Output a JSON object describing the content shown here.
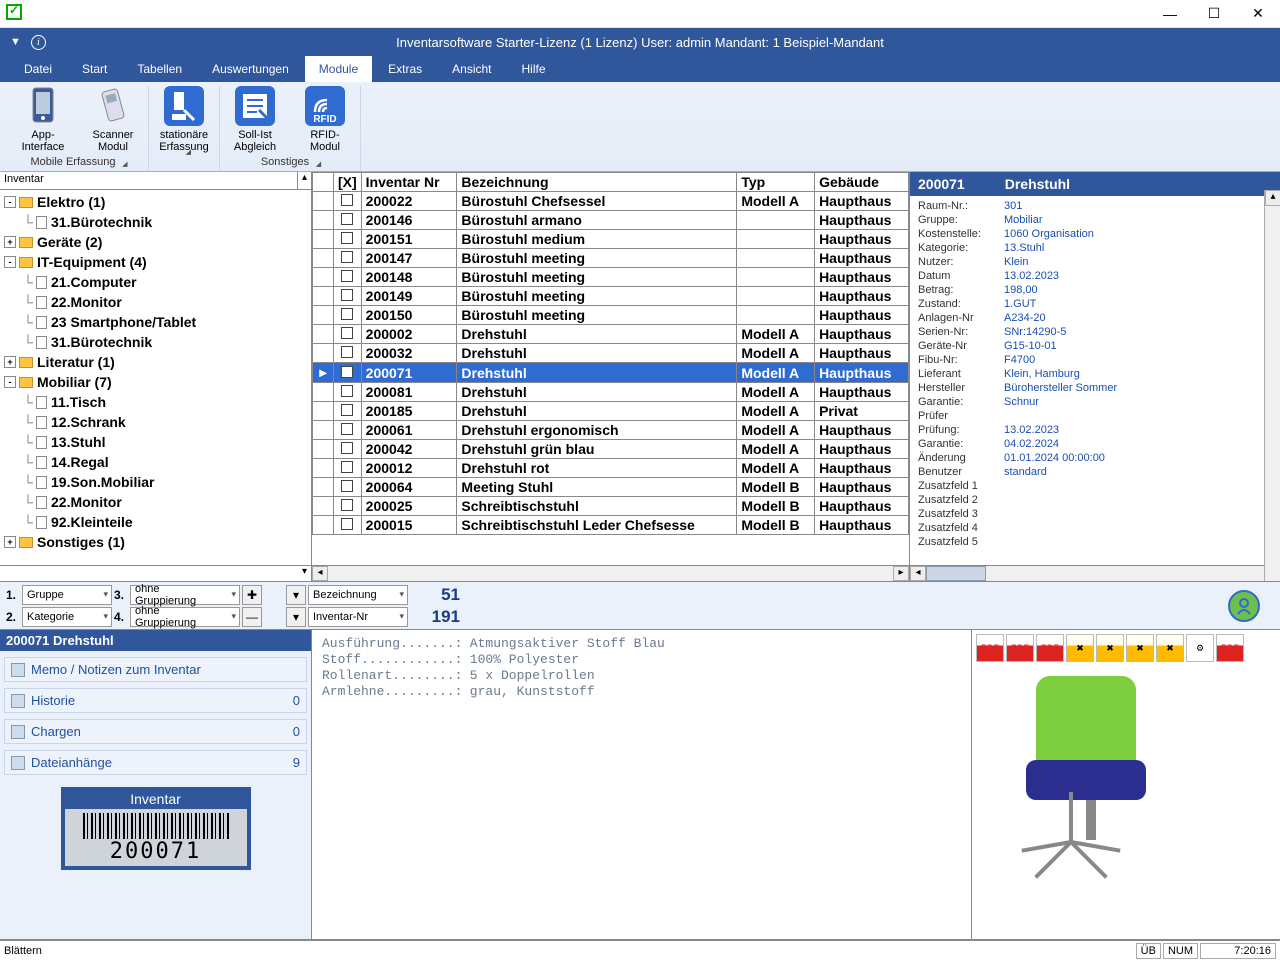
{
  "titlebar": {
    "min": "—",
    "max": "☐",
    "close": "✕"
  },
  "header": {
    "title": "Inventarsoftware Starter-Lizenz (1 Lizenz)    User: admin    Mandant: 1 Beispiel-Mandant"
  },
  "menu": [
    "Datei",
    "Start",
    "Tabellen",
    "Auswertungen",
    "Module",
    "Extras",
    "Ansicht",
    "Hilfe"
  ],
  "menu_active": 4,
  "ribbon": {
    "groups": [
      {
        "label": "Mobile Erfassung",
        "items": [
          {
            "name": "app-interface",
            "label": "App-Interface"
          },
          {
            "name": "scanner-modul",
            "label": "Scanner Modul"
          }
        ]
      },
      {
        "label": " ",
        "items": [
          {
            "name": "stationaere-erfassung",
            "label": "stationäre Erfassung"
          }
        ]
      },
      {
        "label": "Sonstiges",
        "items": [
          {
            "name": "soll-ist",
            "label": "Soll-Ist Abgleich"
          },
          {
            "name": "rfid",
            "label": "RFID-Modul"
          }
        ]
      }
    ]
  },
  "tree": {
    "title": "Inventar",
    "items": [
      {
        "lvl": 0,
        "toggle": "-",
        "icon": "folder",
        "label": "Elektro  (1)"
      },
      {
        "lvl": 1,
        "toggle": "",
        "icon": "doc",
        "label": "31.Bürotechnik"
      },
      {
        "lvl": 0,
        "toggle": "+",
        "icon": "folder",
        "label": "Geräte  (2)"
      },
      {
        "lvl": 0,
        "toggle": "-",
        "icon": "folder",
        "label": "IT-Equipment  (4)"
      },
      {
        "lvl": 1,
        "toggle": "",
        "icon": "doc",
        "label": "21.Computer"
      },
      {
        "lvl": 1,
        "toggle": "",
        "icon": "doc",
        "label": "22.Monitor"
      },
      {
        "lvl": 1,
        "toggle": "",
        "icon": "doc",
        "label": "23 Smartphone/Tablet"
      },
      {
        "lvl": 1,
        "toggle": "",
        "icon": "doc",
        "label": "31.Bürotechnik"
      },
      {
        "lvl": 0,
        "toggle": "+",
        "icon": "folder",
        "label": "Literatur  (1)"
      },
      {
        "lvl": 0,
        "toggle": "-",
        "icon": "folder",
        "label": "Mobiliar  (7)"
      },
      {
        "lvl": 1,
        "toggle": "",
        "icon": "doc",
        "label": "11.Tisch"
      },
      {
        "lvl": 1,
        "toggle": "",
        "icon": "doc",
        "label": "12.Schrank"
      },
      {
        "lvl": 1,
        "toggle": "",
        "icon": "doc",
        "label": "13.Stuhl"
      },
      {
        "lvl": 1,
        "toggle": "",
        "icon": "doc",
        "label": "14.Regal"
      },
      {
        "lvl": 1,
        "toggle": "",
        "icon": "doc",
        "label": "19.Son.Mobiliar"
      },
      {
        "lvl": 1,
        "toggle": "",
        "icon": "doc",
        "label": "22.Monitor"
      },
      {
        "lvl": 1,
        "toggle": "",
        "icon": "doc",
        "label": "92.Kleinteile"
      },
      {
        "lvl": 0,
        "toggle": "+",
        "icon": "folder",
        "label": "Sonstiges  (1)"
      }
    ]
  },
  "grid": {
    "cols": [
      "",
      "[X]",
      "Inventar Nr",
      "Bezeichnung",
      "Typ",
      "Gebäude"
    ],
    "rows": [
      [
        "",
        "",
        "200022",
        "Bürostuhl Chefsessel",
        "Modell A",
        "Haupthaus"
      ],
      [
        "",
        "",
        "200146",
        "Bürostuhl armano",
        "",
        "Haupthaus"
      ],
      [
        "",
        "",
        "200151",
        "Bürostuhl medium",
        "",
        "Haupthaus"
      ],
      [
        "",
        "",
        "200147",
        "Bürostuhl meeting",
        "",
        "Haupthaus"
      ],
      [
        "",
        "",
        "200148",
        "Bürostuhl meeting",
        "",
        "Haupthaus"
      ],
      [
        "",
        "",
        "200149",
        "Bürostuhl meeting",
        "",
        "Haupthaus"
      ],
      [
        "",
        "",
        "200150",
        "Bürostuhl meeting",
        "",
        "Haupthaus"
      ],
      [
        "",
        "",
        "200002",
        "Drehstuhl",
        "Modell A",
        "Haupthaus"
      ],
      [
        "",
        "",
        "200032",
        "Drehstuhl",
        "Modell A",
        "Haupthaus"
      ],
      [
        "▸",
        "",
        "200071",
        "Drehstuhl",
        "Modell A",
        "Haupthaus"
      ],
      [
        "",
        "",
        "200081",
        "Drehstuhl",
        "Modell A",
        "Haupthaus"
      ],
      [
        "",
        "",
        "200185",
        "Drehstuhl",
        "Modell A",
        "Privat"
      ],
      [
        "",
        "",
        "200061",
        "Drehstuhl ergonomisch",
        "Modell A",
        "Haupthaus"
      ],
      [
        "",
        "",
        "200042",
        "Drehstuhl grün blau",
        "Modell A",
        "Haupthaus"
      ],
      [
        "",
        "",
        "200012",
        "Drehstuhl rot",
        "Modell A",
        "Haupthaus"
      ],
      [
        "",
        "",
        "200064",
        "Meeting Stuhl",
        "Modell B",
        "Haupthaus"
      ],
      [
        "",
        "",
        "200025",
        "Schreibtischstuhl",
        "Modell B",
        "Haupthaus"
      ],
      [
        "",
        "",
        "200015",
        "Schreibtischstuhl Leder Chefsesse",
        "Modell B",
        "Haupthaus"
      ]
    ],
    "selected": 9
  },
  "detail": {
    "id": "200071",
    "name": "Drehstuhl",
    "rows": [
      [
        "Raum-Nr.:",
        "301"
      ],
      [
        "Gruppe:",
        "Mobiliar"
      ],
      [
        "Kostenstelle:",
        "1060 Organisation"
      ],
      [
        "Kategorie:",
        "13.Stuhl"
      ],
      [
        "Nutzer:",
        "Klein"
      ],
      [
        "Datum",
        "13.02.2023"
      ],
      [
        "Betrag:",
        "198,00"
      ],
      [
        "Zustand:",
        "1.GUT"
      ],
      [
        "Anlagen-Nr",
        "A234-20"
      ],
      [
        "Serien-Nr:",
        "SNr:14290-5"
      ],
      [
        "Geräte-Nr",
        "G15-10-01"
      ],
      [
        "Fibu-Nr:",
        "F4700"
      ],
      [
        "Lieferant",
        "Klein, Hamburg"
      ],
      [
        "Hersteller",
        "Bürohersteller Sommer"
      ],
      [
        "Garantie:",
        "Schnur"
      ],
      [
        "Prüfer",
        ""
      ],
      [
        "Prüfung:",
        "13.02.2023"
      ],
      [
        "Garantie:",
        "04.02.2024"
      ],
      [
        "Änderung",
        "01.01.2024 00:00:00"
      ],
      [
        "Benutzer",
        "standard"
      ],
      [
        "Zusatzfeld 1",
        ""
      ],
      [
        "Zusatzfeld 2",
        ""
      ],
      [
        "Zusatzfeld 3",
        ""
      ],
      [
        "Zusatzfeld 4",
        ""
      ],
      [
        "Zusatzfeld 5",
        ""
      ]
    ]
  },
  "filters": {
    "g1_label": "1.",
    "g1": "Gruppe",
    "g3_label": "3.",
    "g3": "ohne Gruppierung",
    "g2_label": "2.",
    "g2": "Kategorie",
    "g4_label": "4.",
    "g4": "ohne Gruppierung",
    "c1": "Bezeichnung",
    "c2": "Inventar-Nr",
    "n1": "51",
    "n2": "191"
  },
  "bl": {
    "header": "200071 Drehstuhl",
    "rows": [
      {
        "label": "Memo / Notizen zum Inventar",
        "count": ""
      },
      {
        "label": "Historie",
        "count": "0"
      },
      {
        "label": "Chargen",
        "count": "0"
      },
      {
        "label": "Dateianhänge",
        "count": "9"
      }
    ],
    "barcode_title": "Inventar",
    "barcode_num": "200071"
  },
  "memo": [
    [
      "Ausführung.......:",
      "Atmungsaktiver Stoff Blau"
    ],
    [
      "Stoff............:",
      "100% Polyester"
    ],
    [
      "Rollenart........:",
      "5 x Doppelrollen"
    ],
    [
      "Armlehne.........:",
      "grau, Kunststoff"
    ]
  ],
  "doc_icons": [
    "PDF",
    "PDF",
    "PDF",
    "X",
    "X",
    "X",
    "X",
    "⚙",
    "PDF"
  ],
  "statusbar": {
    "left": "Blättern",
    "ub": "ÜB",
    "num": "NUM",
    "time": "7:20:16"
  }
}
